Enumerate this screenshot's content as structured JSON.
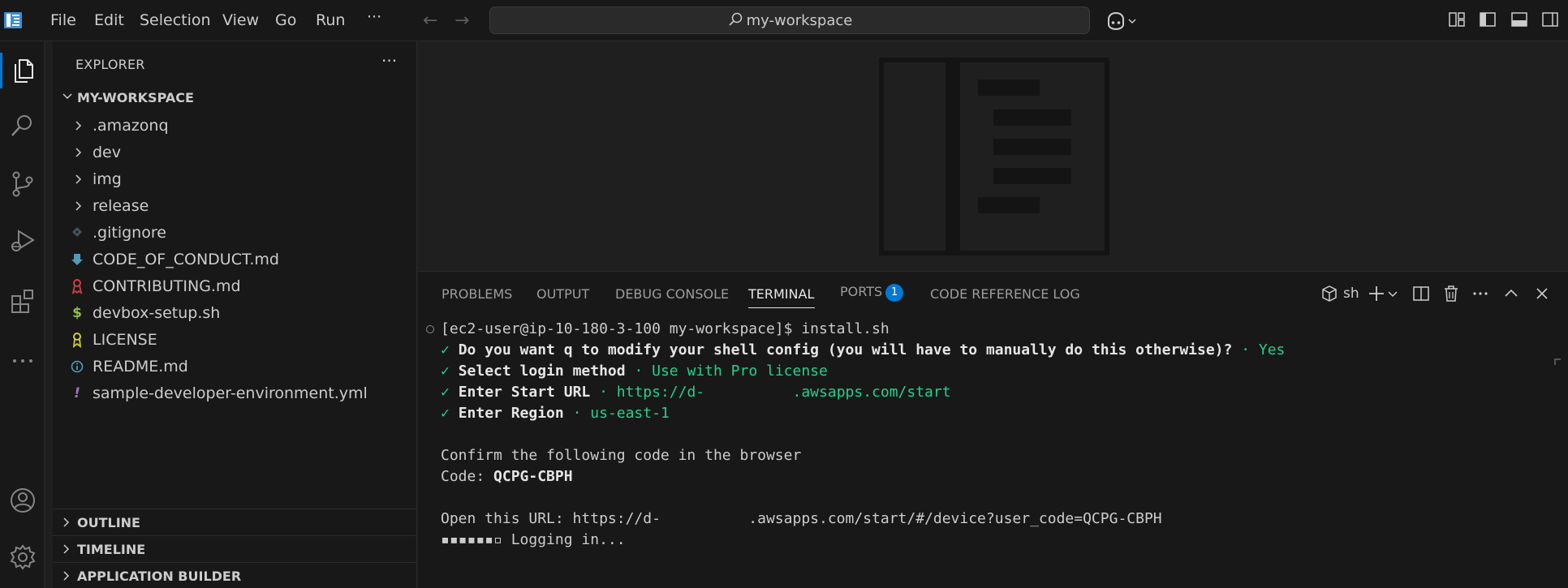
{
  "titlebar": {
    "menu": [
      "File",
      "Edit",
      "Selection",
      "View",
      "Go",
      "Run"
    ],
    "more": "···",
    "search_text": "my-workspace"
  },
  "sidebar": {
    "title": "EXPLORER",
    "more": "···",
    "workspace": "MY-WORKSPACE",
    "tree": [
      {
        "label": ".amazonq",
        "kind": "folder"
      },
      {
        "label": "dev",
        "kind": "folder"
      },
      {
        "label": "img",
        "kind": "folder"
      },
      {
        "label": "release",
        "kind": "folder"
      },
      {
        "label": ".gitignore",
        "kind": "git",
        "icon_color": "#41535b"
      },
      {
        "label": "CODE_OF_CONDUCT.md",
        "kind": "markdown-info",
        "icon_color": "#519aba"
      },
      {
        "label": "CONTRIBUTING.md",
        "kind": "ribbon",
        "icon_color": "#cc3e44"
      },
      {
        "label": "devbox-setup.sh",
        "kind": "shell",
        "icon_color": "#8dc149"
      },
      {
        "label": "LICENSE",
        "kind": "license",
        "icon_color": "#cbcb41"
      },
      {
        "label": "README.md",
        "kind": "info",
        "icon_color": "#519aba"
      },
      {
        "label": "sample-developer-environment.yml",
        "kind": "yaml",
        "icon_color": "#a074c4"
      }
    ],
    "sections": [
      "OUTLINE",
      "TIMELINE",
      "APPLICATION BUILDER"
    ]
  },
  "panel": {
    "tabs": [
      "PROBLEMS",
      "OUTPUT",
      "DEBUG CONSOLE",
      "TERMINAL",
      "PORTS",
      "CODE REFERENCE LOG"
    ],
    "active_tab": "TERMINAL",
    "ports_badge": "1",
    "shell_name": "sh"
  },
  "terminal": {
    "prompt": "[ec2-user@ip-10-180-3-100 my-workspace]$ install.sh",
    "check": "✓",
    "q1": "Do you want q to modify your shell config (you will have to manually do this otherwise)?",
    "a1": "· Yes",
    "q2": "Select login method",
    "a2": "· Use with Pro license",
    "q3": "Enter Start URL",
    "a3": "· https://d-          .awsapps.com/start",
    "q4": "Enter Region",
    "a4": "· us-east-1",
    "confirm": "Confirm the following code in the browser",
    "code": "Code: ",
    "code_value": "QCPG-CBPH",
    "open_url": "Open this URL: https://d-          .awsapps.com/start/#/device?user_code=QCPG-CBPH",
    "spinner": "▪▪▪▪▪▪▫",
    "logging": " Logging in..."
  },
  "colors": {
    "accent": "#0078d4",
    "terminal_green": "#23d18b"
  }
}
